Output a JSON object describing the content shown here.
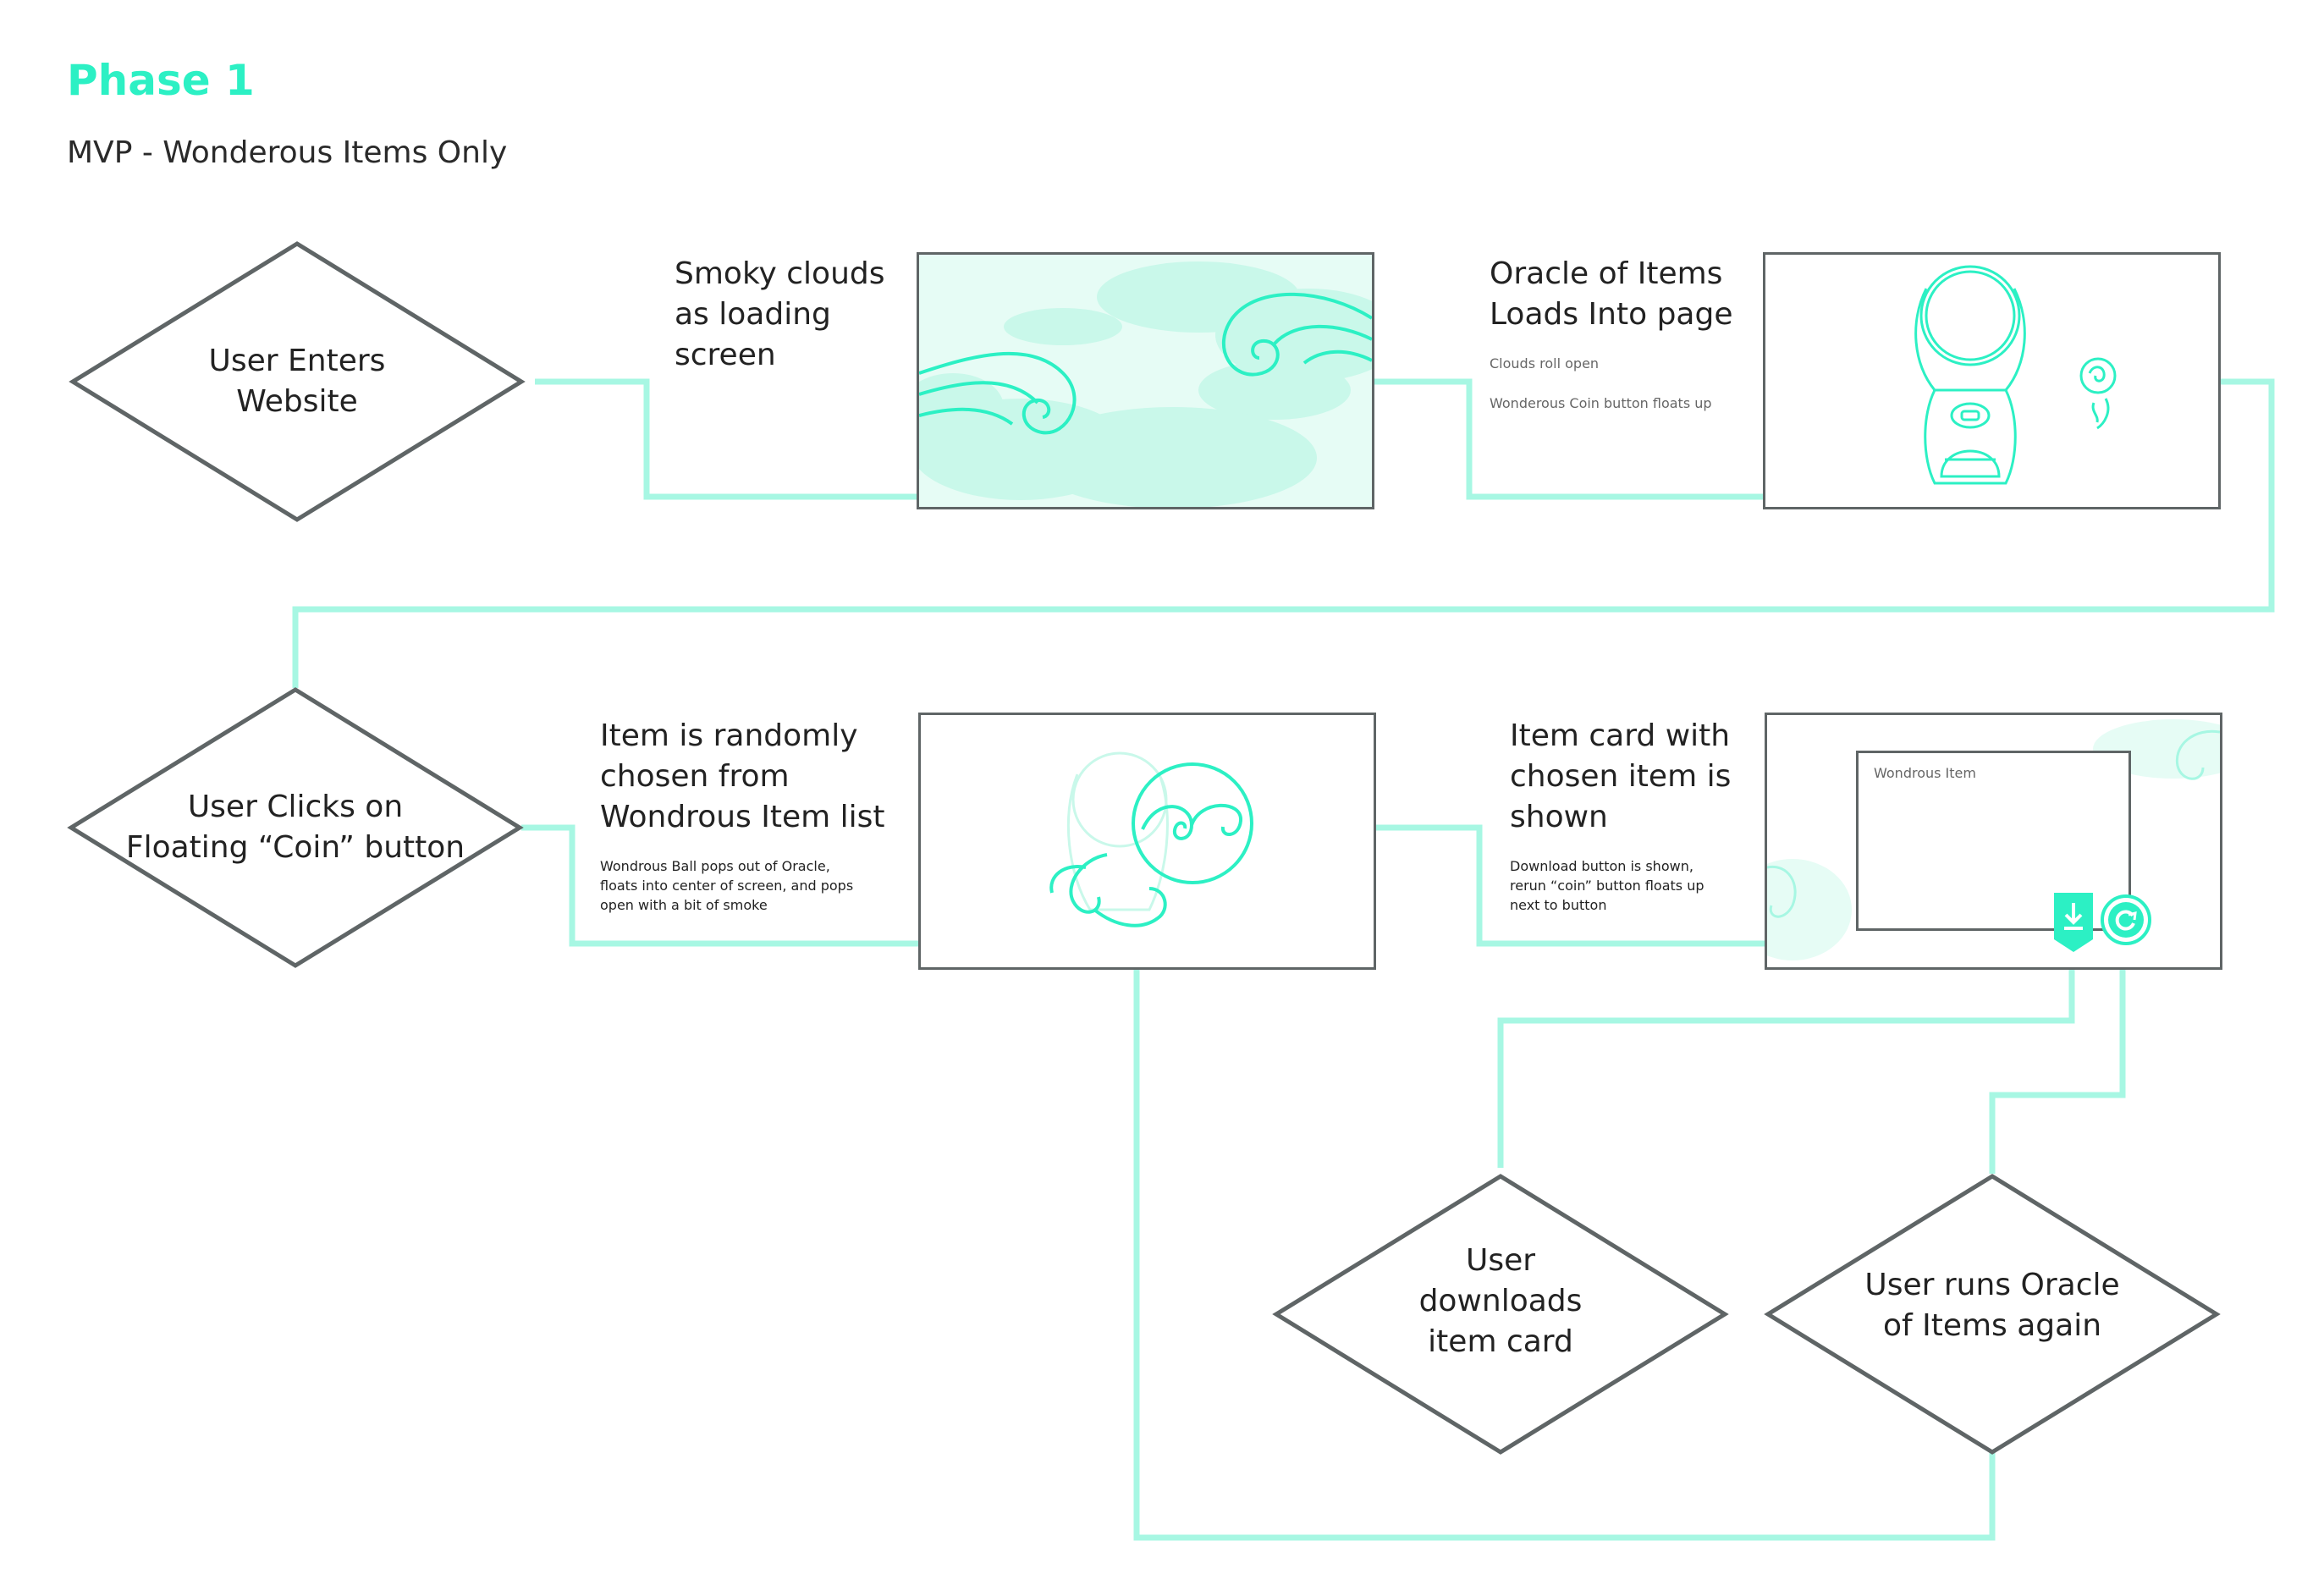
{
  "header": {
    "title": "Phase 1",
    "subtitle": "MVP - Wonderous Items Only"
  },
  "decisions": {
    "enter": "User Enters\nWebsite",
    "click_coin": "User Clicks on\nFloating “Coin” button",
    "download": "User\ndownloads\nitem card",
    "run_again": "User runs Oracle\nof Items again"
  },
  "steps": {
    "loading": {
      "caption": "Smoky clouds\nas loading\nscreen"
    },
    "oracle": {
      "caption": "Oracle of Items\nLoads Into page",
      "note1": "Clouds roll open",
      "note2": "Wonderous Coin button floats up"
    },
    "random": {
      "caption": "Item is randomly\nchosen from\nWondrous Item list",
      "note": "Wondrous Ball pops out of Oracle,\nfloats into center of screen, and pops\nopen with a bit of smoke"
    },
    "card": {
      "caption": "Item card with\nchosen item is\nshown",
      "note": "Download button is shown,\nrerun “coin” button floats up\nnext to button",
      "card_label": "Wondrous Item"
    }
  },
  "colors": {
    "accent": "#2cf0c4",
    "connector": "#a7f7e3",
    "stroke": "#5f6566",
    "cloud_fill": "#c9f8ea"
  },
  "icons": [
    "cloud-swirl-icon",
    "oracle-machine-icon",
    "coin-icon",
    "wondrous-ball-icon",
    "download-icon",
    "rerun-icon"
  ]
}
